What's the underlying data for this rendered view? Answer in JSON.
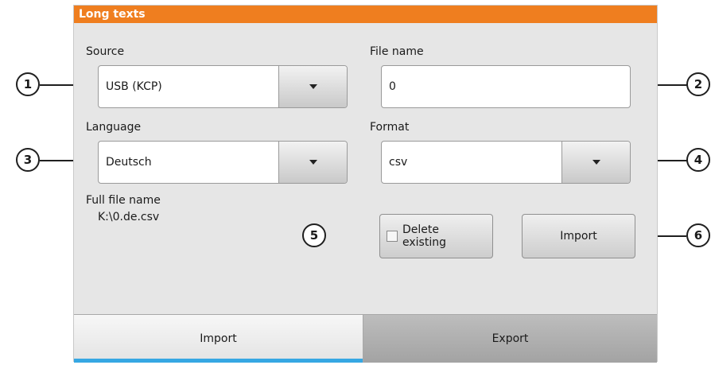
{
  "window": {
    "title": "Long texts"
  },
  "source": {
    "label": "Source",
    "value": "USB (KCP)"
  },
  "file_name": {
    "label": "File name",
    "value": "0"
  },
  "language": {
    "label": "Language",
    "value": "Deutsch"
  },
  "format": {
    "label": "Format",
    "value": "csv"
  },
  "full_file_name": {
    "label": "Full file name",
    "value": "K:\\0.de.csv"
  },
  "delete_existing": {
    "label_line1": "Delete",
    "label_line2": "existing",
    "checked": false
  },
  "import_button": {
    "label": "Import"
  },
  "tabs": [
    {
      "label": "Import",
      "active": true
    },
    {
      "label": "Export",
      "active": false
    }
  ],
  "callouts": [
    "1",
    "2",
    "3",
    "4",
    "5",
    "6"
  ],
  "colors": {
    "title_bar": "#ef7e1f",
    "active_tab_indicator": "#36a7e3",
    "panel_bg": "#e6e6e6"
  }
}
